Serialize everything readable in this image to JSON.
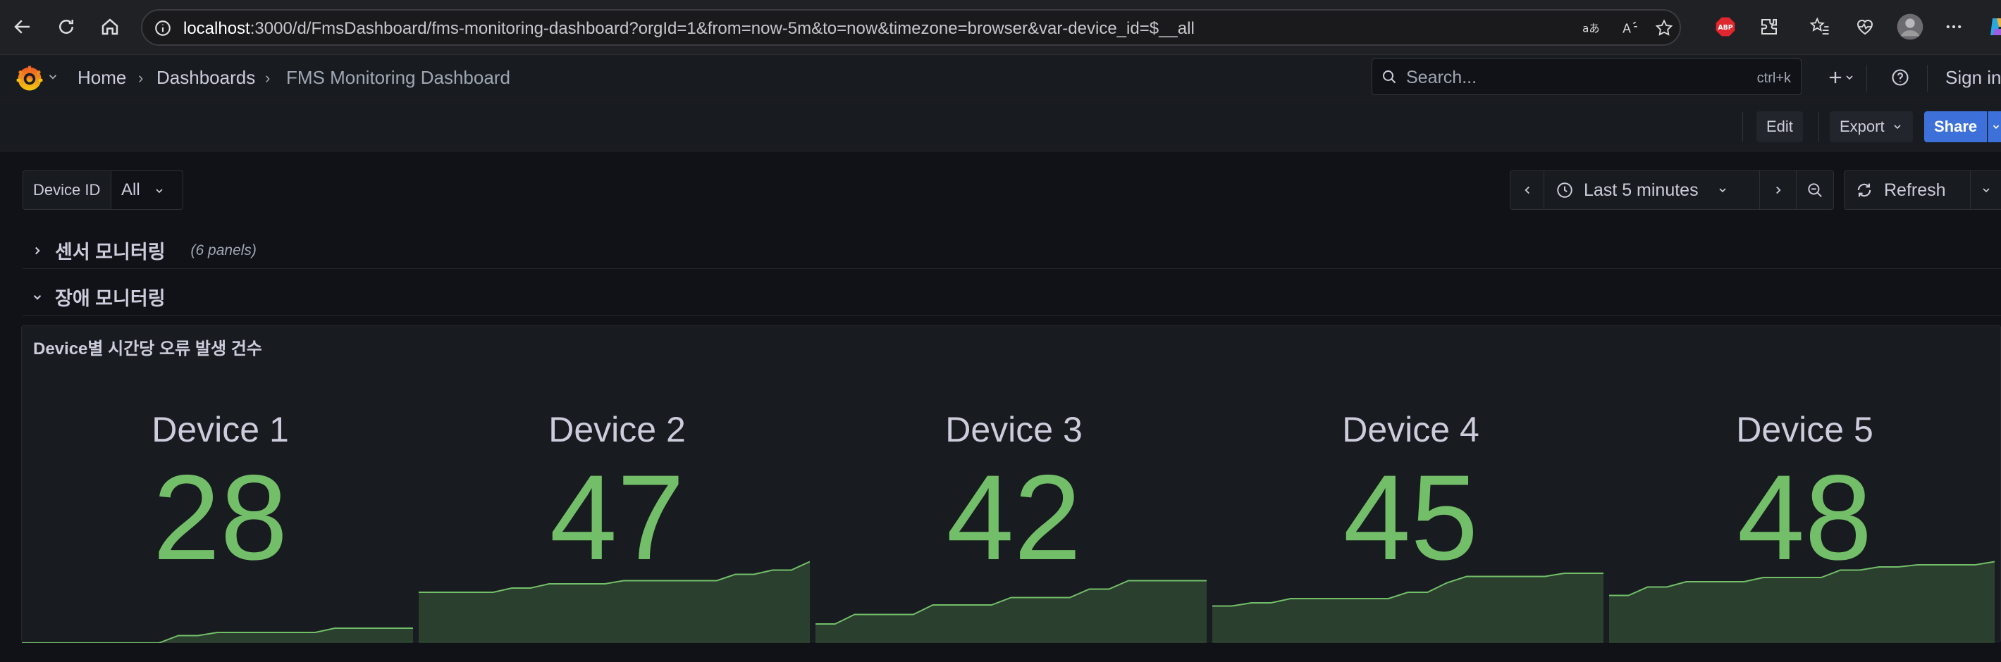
{
  "browser": {
    "url_host": "localhost",
    "url_rest": ":3000/d/FmsDashboard/fms-monitoring-dashboard?orgId=1&from=now-5m&to=now&timezone=browser&var-device_id=$__all",
    "extension_abp": "ABP"
  },
  "topbar": {
    "breadcrumbs": [
      "Home",
      "Dashboards",
      "FMS Monitoring Dashboard"
    ],
    "search_placeholder": "Search...",
    "search_shortcut": "ctrl+k",
    "sign_in": "Sign in"
  },
  "toolbar": {
    "edit": "Edit",
    "export": "Export",
    "share": "Share"
  },
  "variables": {
    "device_id_label": "Device ID",
    "device_id_value": "All"
  },
  "time_picker": {
    "range": "Last 5 minutes",
    "refresh": "Refresh"
  },
  "rows": [
    {
      "title": "센서 모니터링",
      "collapsed": true,
      "count": "(6 panels)"
    },
    {
      "title": "장애 모니터링",
      "collapsed": false
    }
  ],
  "panel": {
    "title": "Device별 시간당 오류 발생 건수",
    "color": "#73bf69",
    "stats": [
      {
        "name": "Device 1",
        "value": "28",
        "spark": [
          0.0,
          0.0,
          0.0,
          0.0,
          0.0,
          0.0,
          0.0,
          0.0,
          0.07,
          0.07,
          0.1,
          0.1,
          0.1,
          0.1,
          0.1,
          0.1,
          0.14,
          0.14,
          0.14,
          0.14,
          0.14
        ]
      },
      {
        "name": "Device 2",
        "value": "47",
        "spark": [
          0.48,
          0.48,
          0.48,
          0.48,
          0.48,
          0.52,
          0.52,
          0.56,
          0.56,
          0.56,
          0.56,
          0.59,
          0.59,
          0.59,
          0.59,
          0.59,
          0.59,
          0.65,
          0.65,
          0.69,
          0.69,
          0.77
        ]
      },
      {
        "name": "Device 3",
        "value": "42",
        "spark": [
          0.18,
          0.18,
          0.27,
          0.27,
          0.27,
          0.27,
          0.36,
          0.36,
          0.36,
          0.36,
          0.43,
          0.43,
          0.43,
          0.43,
          0.51,
          0.51,
          0.59,
          0.59,
          0.59,
          0.59,
          0.59
        ]
      },
      {
        "name": "Device 4",
        "value": "45",
        "spark": [
          0.35,
          0.35,
          0.38,
          0.38,
          0.42,
          0.42,
          0.42,
          0.42,
          0.42,
          0.42,
          0.48,
          0.48,
          0.57,
          0.63,
          0.63,
          0.63,
          0.63,
          0.63,
          0.66,
          0.66,
          0.66
        ]
      },
      {
        "name": "Device 5",
        "value": "48",
        "spark": [
          0.45,
          0.45,
          0.53,
          0.53,
          0.58,
          0.58,
          0.58,
          0.58,
          0.62,
          0.62,
          0.62,
          0.62,
          0.69,
          0.69,
          0.72,
          0.72,
          0.74,
          0.74,
          0.74,
          0.74,
          0.77
        ]
      }
    ]
  }
}
